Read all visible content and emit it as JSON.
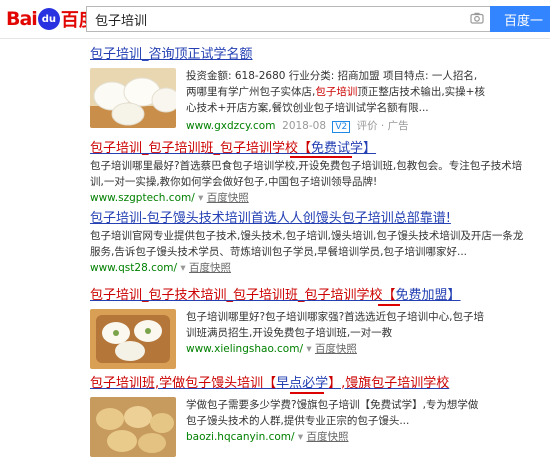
{
  "header": {
    "logo_bai": "Bai",
    "logo_paw": "du",
    "logo_cn": "百度",
    "query": "包子培训",
    "search_button": "百度一"
  },
  "results": [
    {
      "title": "包子培训_咨询顶正试学名额",
      "snippet_a": "投资金额: 618-2680  行业分类: 招商加盟  项目特点: 一人招名, 两哪里有学广州包子实体店,",
      "snippet_em": "包子培训",
      "snippet_b": "顶正整店技术输出,实操+核心技术+开店方案,餐饮创业包子培训试学名额有限...",
      "url": "www.gxdzcy.com",
      "date": "2018-08",
      "v2": "V2",
      "meta": "评价 · 广告"
    },
    {
      "title_a": "包子培训_包子培训班_包子培训学校【",
      "title_b": "免费试学",
      "title_c": "】",
      "snippet": "包子培训哪里最好?首选蔡巴食包子培训学校,开设免费包子培训班,包教包会。专注包子技术培训,一对一实操,教你如何学会做好包子,中国包子培训领导品牌!",
      "url": "www.szgptech.com/",
      "snapshot": "百度快照"
    },
    {
      "title": "包子培训-包子馒头技术培训首选人人创馒头包子培训总部靠谱!",
      "snippet": "包子培训官网专业提供包子技术,馒头技术,包子培训,馒头培训,包子馒头技术培训及开店一条龙服务,告诉包子馒头技术学员、苛炼培训包子学员,早餐培训学员,包子培训哪家好...",
      "url": "www.qst28.com/",
      "snapshot": "百度快照"
    },
    {
      "title_a": "包子培训_包子技术培训_包子培训班_包子培训学校【",
      "title_b": "免费加盟",
      "title_c": "】",
      "snippet": "包子培训哪里好?包子培训哪家强?首选选近包子培训中心,包子培训班满员招生,开设免费包子培训班,一对一教",
      "url": "www.xielingshao.com/",
      "snapshot": "百度快照"
    },
    {
      "title_a": "包子培训班,学做包子馒头培训【",
      "title_b": "早点必学",
      "title_c": "】,馒旗包子培训学校",
      "snippet": "学做包子需要多少学费?馒旗包子培训【免费试学】,专为想学做包子馒头技术的人群,提供专业正宗的包子馒头...",
      "url": "baozi.hqcanyin.com/",
      "snapshot": "百度快照"
    }
  ]
}
